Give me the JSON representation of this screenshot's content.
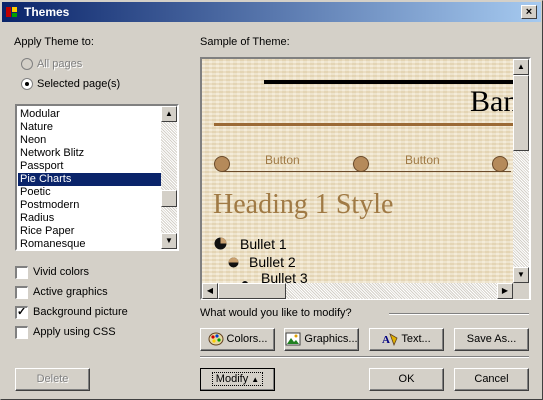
{
  "window": {
    "title": "Themes",
    "close_label": "×"
  },
  "apply": {
    "heading": "Apply Theme to:",
    "all_pages": "All pages",
    "selected_pages": "Selected page(s)",
    "selected_pages_checked": true
  },
  "theme_list": {
    "items": [
      "Modular",
      "Nature",
      "Neon",
      "Network Blitz",
      "Passport",
      "Pie Charts",
      "Poetic",
      "Postmodern",
      "Radius",
      "Rice Paper",
      "Romanesque"
    ],
    "selected": "Pie Charts"
  },
  "options": [
    {
      "label": "Vivid colors",
      "checked": false
    },
    {
      "label": "Active graphics",
      "checked": false
    },
    {
      "label": "Background picture",
      "checked": true
    },
    {
      "label": "Apply using CSS",
      "checked": false
    }
  ],
  "sample": {
    "heading": "Sample of Theme:",
    "banner": "Ban",
    "nav_buttons": [
      "Button",
      "Button"
    ],
    "heading1": "Heading 1 Style",
    "bullets": [
      "Bullet 1",
      "Bullet 2",
      "Bullet 3"
    ]
  },
  "modify_prompt": "What would you like to modify?",
  "buttons": {
    "colors": "Colors...",
    "graphics": "Graphics...",
    "text": "Text...",
    "save_as": "Save As...",
    "delete": "Delete",
    "modify": "Modify",
    "ok": "OK",
    "cancel": "Cancel"
  },
  "colors": {
    "title_start": "#0a246a",
    "title_end": "#a6caf0",
    "theme_accent": "#a07a45",
    "face": "#d4d0c8"
  }
}
